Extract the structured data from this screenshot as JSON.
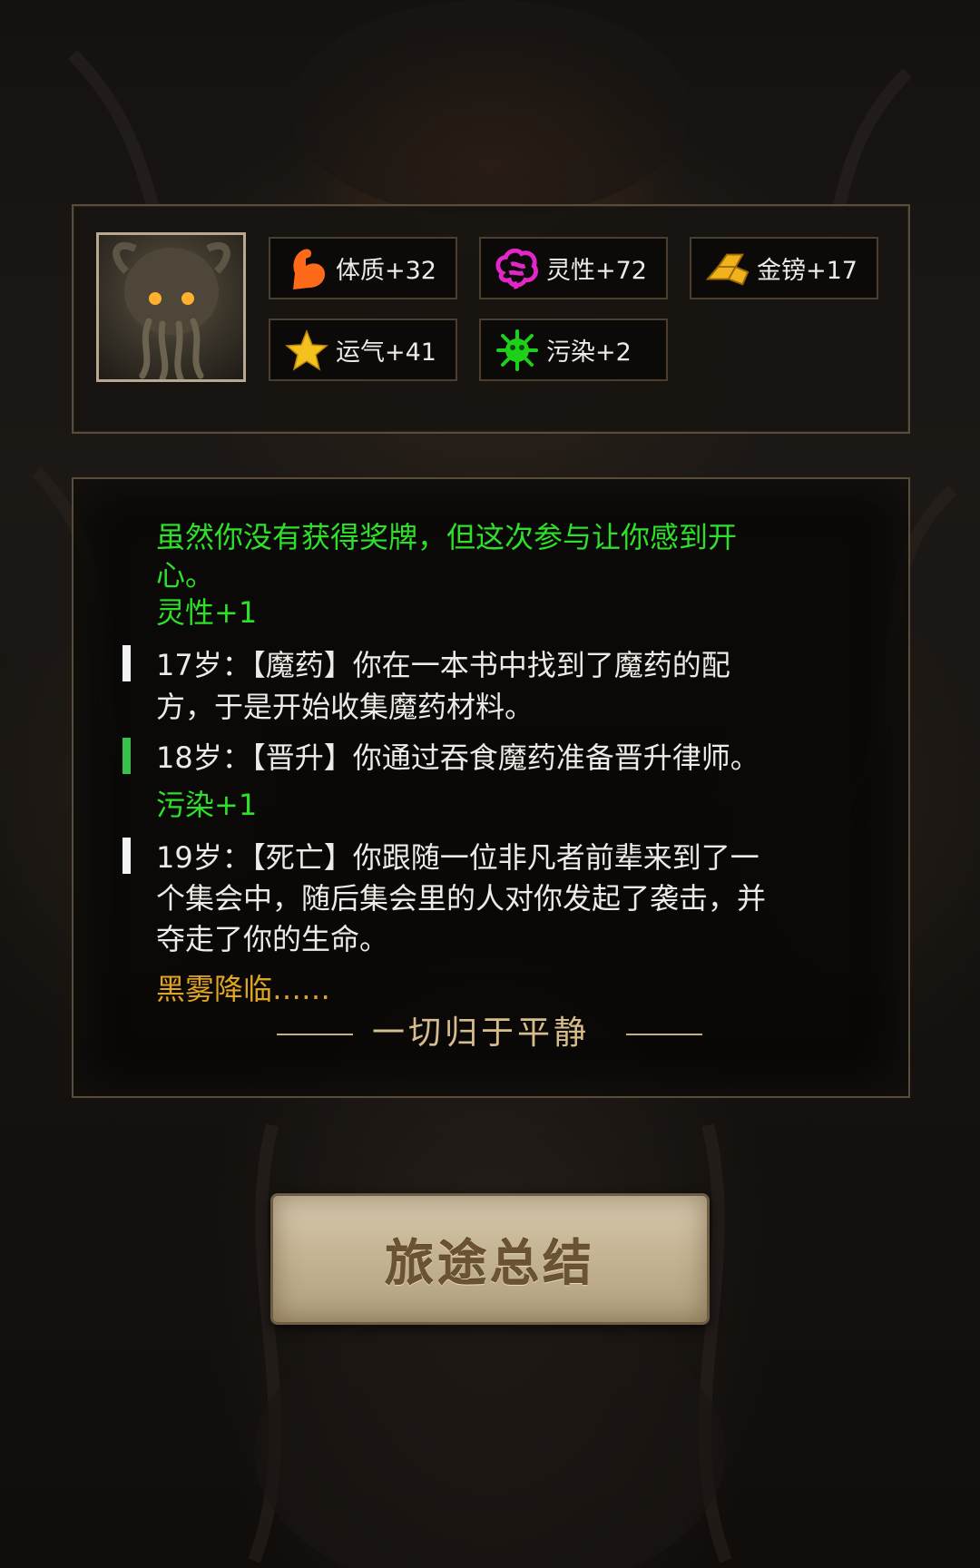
{
  "stats": [
    {
      "icon": "muscle-icon",
      "label": "体质+32",
      "color": "#ff6a1a"
    },
    {
      "icon": "brain-icon",
      "label": "灵性+72",
      "color": "#e426c8"
    },
    {
      "icon": "gold-bars-icon",
      "label": "金镑+17",
      "color": "#f2b21c"
    },
    {
      "icon": "star-icon",
      "label": "运气+41",
      "color": "#f4c21f"
    },
    {
      "icon": "virus-icon",
      "label": "污染+2",
      "color": "#1fd01a"
    }
  ],
  "log": {
    "intro_line1": "虽然你没有获得奖牌，但这次参与让你感到开",
    "intro_line2": "心。",
    "intro_bonus": "灵性+1",
    "event17_line1": "17岁：【魔药】你在一本书中找到了魔药的配",
    "event17_line2": "方，于是开始收集魔药材料。",
    "event18_line1": "18岁：【晋升】你通过吞食魔药准备晋升律师。",
    "event18_bonus": "污染+1",
    "event19_line1": "19岁：【死亡】你跟随一位非凡者前辈来到了一",
    "event19_line2": "个集会中，随后集会里的人对你发起了袭击，并",
    "event19_line3": "夺走了你的生命。",
    "fog": "黑雾降临……",
    "ending": "一切归于平静"
  },
  "button": {
    "label": "旅途总结"
  },
  "colors": {
    "bonus_green": "#2ee02a",
    "fog_gold": "#e0a521",
    "bar_white": "#f2f2f2",
    "bar_green": "#39c24a"
  }
}
